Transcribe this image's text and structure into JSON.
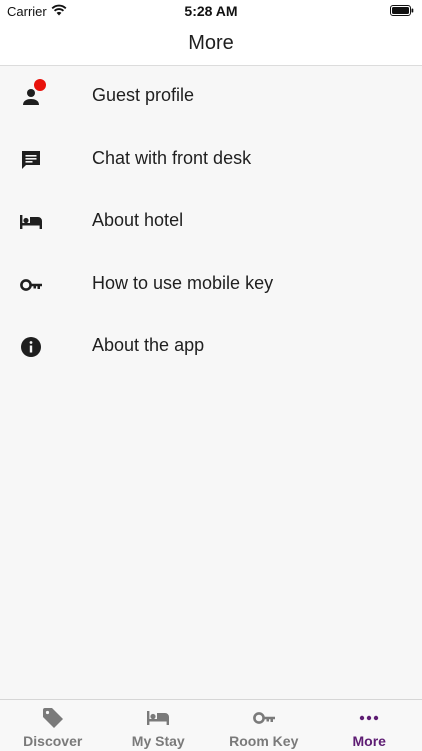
{
  "status_bar": {
    "carrier": "Carrier",
    "time": "5:28 AM"
  },
  "header": {
    "title": "More"
  },
  "menu": {
    "items": [
      {
        "label": "Guest profile",
        "icon": "person-icon"
      },
      {
        "label": "Chat with front desk",
        "icon": "chat-icon",
        "has_badge": true
      },
      {
        "label": "About hotel",
        "icon": "bed-icon"
      },
      {
        "label": "How to use mobile key",
        "icon": "key-icon"
      },
      {
        "label": "About the app",
        "icon": "info-icon"
      }
    ]
  },
  "tabs": [
    {
      "label": "Discover",
      "icon": "tag-icon"
    },
    {
      "label": "My Stay",
      "icon": "bed-icon"
    },
    {
      "label": "Room Key",
      "icon": "key-icon"
    },
    {
      "label": "More",
      "icon": "more-dots-icon",
      "active": true
    }
  ],
  "colors": {
    "accent": "#5e1d73",
    "badge": "#e8120c",
    "tab_inactive": "#7a7a7a"
  }
}
